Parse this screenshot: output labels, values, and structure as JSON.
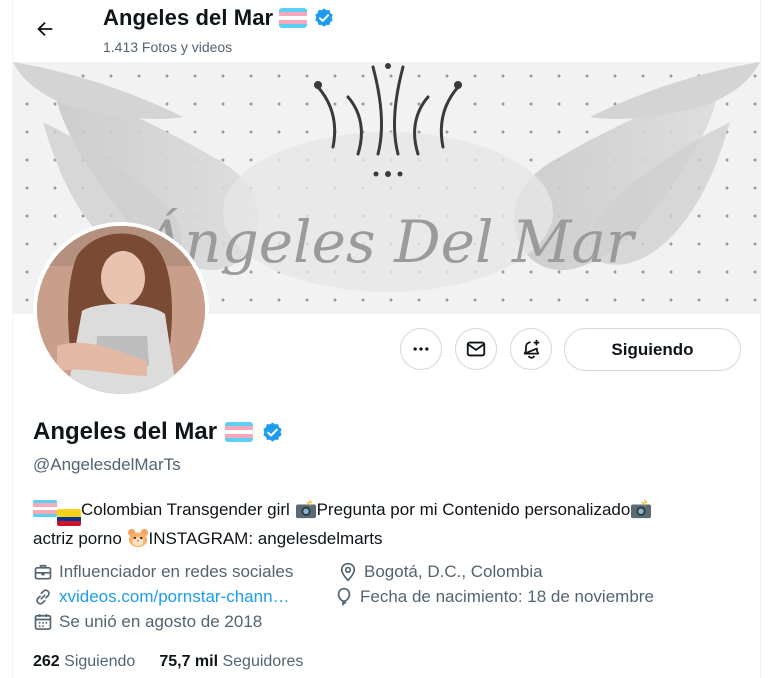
{
  "header": {
    "name": "Angeles del Mar",
    "subtitle": "1.413 Fotos y videos"
  },
  "banner": {
    "logo_text": "Ángeles Del Mar"
  },
  "profile": {
    "name": "Angeles del Mar",
    "handle": "@AngelesdelMarTs",
    "flag_colors": [
      "#5bcefa",
      "#f5a9b8",
      "#ffffff",
      "#f5a9b8",
      "#5bcefa"
    ],
    "verified_color": "#1d9bf0"
  },
  "actions": {
    "more_icon": "more-icon",
    "message_icon": "mail-icon",
    "notify_icon": "bell-plus-icon",
    "follow_label": "Siguiendo"
  },
  "bio": {
    "part1": "Colombian Transgender girl ",
    "part2": "Pregunta por mi Contenido personalizado",
    "part3": "actriz porno ",
    "part4": "INSTAGRAM: angelesdelmarts"
  },
  "meta": {
    "category": "Influenciador en redes sociales",
    "location": "Bogotá, D.C., Colombia",
    "link": "xvideos.com/pornstar-chann…",
    "birthday": "Fecha de nacimiento: 18 de noviembre",
    "joined": "Se unió en agosto de 2018"
  },
  "stats": {
    "following_count": "262",
    "following_label": "Siguiendo",
    "followers_count": "75,7 mil",
    "followers_label": "Seguidores"
  }
}
